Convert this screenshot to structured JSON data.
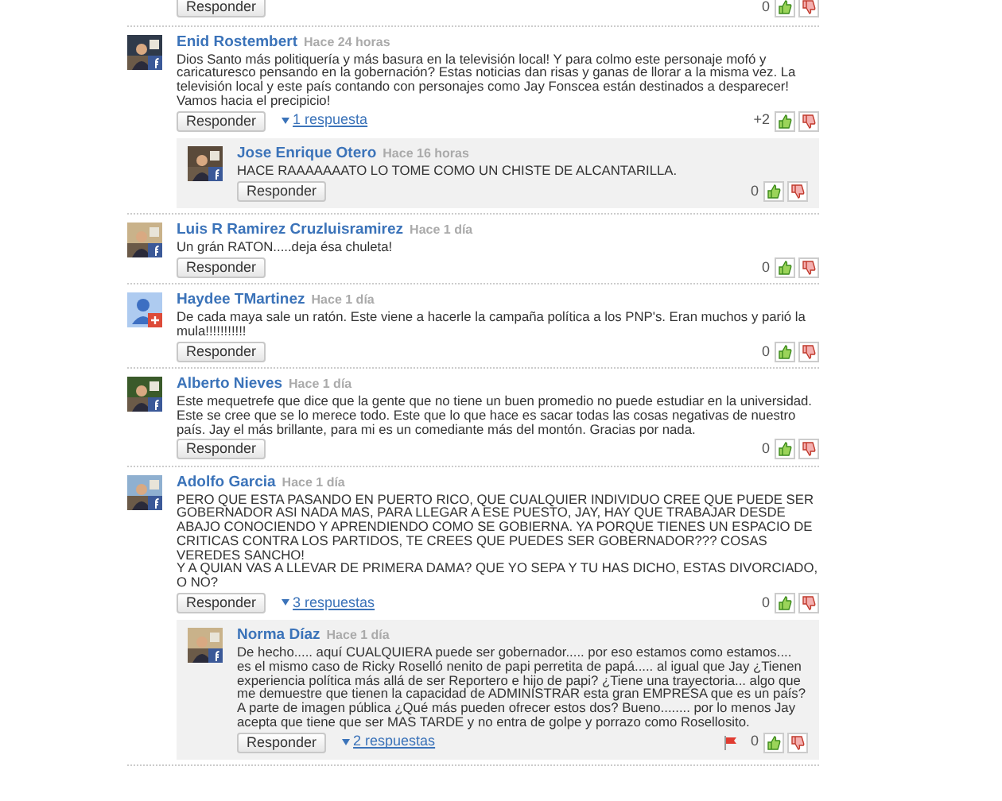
{
  "comments": [
    {
      "kind": "partial",
      "reply_label": "Responder",
      "score": "0"
    },
    {
      "kind": "comment",
      "author": "Enid Rostembert",
      "time": "Hace 24 horas",
      "avatar": {
        "kind": "facebook"
      },
      "text": "Dios Santo más politiquería y más basura en la televisión local! Y para colmo este personaje mofó y caricaturesco pensando en la gobernación? Estas noticias dan risas y ganas de llorar a la misma vez. La televisión local y este país contando con personajes como Jay Fonscea están destinados a desparecer! Vamos hacia el precipicio!",
      "reply_label": "Responder",
      "replies_link": "1 respuesta",
      "score": "+2",
      "flagged": false,
      "replies": [
        {
          "author": "Jose Enrique Otero",
          "time": "Hace 16 horas",
          "avatar": {
            "kind": "facebook"
          },
          "text": "HACE RAAAAAAATO LO TOME COMO UN CHISTE DE ALCANTARILLA.",
          "reply_label": "Responder",
          "score": "0",
          "flagged": false
        }
      ]
    },
    {
      "kind": "comment",
      "author": "Luis R Ramirez Cruzluisramirez",
      "time": "Hace 1 día",
      "avatar": {
        "kind": "facebook"
      },
      "text": "Un grán RATON.....deja ésa chuleta!",
      "reply_label": "Responder",
      "score": "0",
      "flagged": false
    },
    {
      "kind": "comment",
      "author": "Haydee TMartinez",
      "time": "Hace 1 día",
      "avatar": {
        "kind": "google"
      },
      "text": "De cada maya sale un ratón. Este viene a hacerle la campaña política a los PNP's. Eran muchos y parió la mula!!!!!!!!!!!",
      "reply_label": "Responder",
      "score": "0",
      "flagged": false
    },
    {
      "kind": "comment",
      "author": "Alberto Nieves",
      "time": "Hace 1 día",
      "avatar": {
        "kind": "facebook"
      },
      "text": "Este mequetrefe que dice que la gente que no tiene un buen promedio no puede estudiar en la universidad. Este se cree que se lo merece todo. Este que lo que hace es sacar todas las cosas negativas de nuestro país. Jay el más brillante, para mi es un comediante más del montón. Gracias por nada.",
      "reply_label": "Responder",
      "score": "0",
      "flagged": false
    },
    {
      "kind": "comment",
      "author": "Adolfo Garcia",
      "time": "Hace 1 día",
      "avatar": {
        "kind": "facebook"
      },
      "text": "PERO QUE ESTA PASANDO EN PUERTO RICO, QUE CUALQUIER INDIVIDUO CREE QUE PUEDE SER GOBERNADOR ASI NADA MAS, PARA LLEGAR A ESE PUESTO, JAY, HAY QUE TRABAJAR DESDE ABAJO CONOCIENDO Y APRENDIENDO COMO SE GOBIERNA. YA PORQUE TIENES UN ESPACIO DE CRITICAS CONTRA LOS PARTIDOS, TE CREES QUE PUEDES SER GOBERNADOR??? COSAS VEREDES SANCHO!\nY A QUIAN VAS A LLEVAR DE PRIMERA DAMA? QUE YO SEPA Y TU HAS DICHO, ESTAS DIVORCIADO, O NO?",
      "reply_label": "Responder",
      "replies_link": "3 respuestas",
      "score": "0",
      "flagged": false,
      "replies": [
        {
          "author": "Norma Díaz",
          "time": "Hace 1 día",
          "avatar": {
            "kind": "facebook"
          },
          "text": "De hecho..... aquí CUALQUIERA puede ser gobernador..... por eso estamos como estamos.... es el mismo caso de Ricky Roselló nenito de papi perretita de papá..... al igual que Jay ¿Tienen experiencia política más allá de ser Reportero e hijo de papi? ¿Tiene una trayectoria... algo que me demuestre que tienen la capacidad de ADMINISTRAR esta gran EMPRESA que es un país? A parte de imagen pública ¿Qué más pueden ofrecer estos dos? Bueno........ por lo menos Jay acepta que tiene que ser MAS TARDE y no entra de golpe y porrazo como Rosellosito.",
          "reply_label": "Responder",
          "replies_link": "2 respuestas",
          "score": "0",
          "flagged": true
        }
      ]
    }
  ]
}
